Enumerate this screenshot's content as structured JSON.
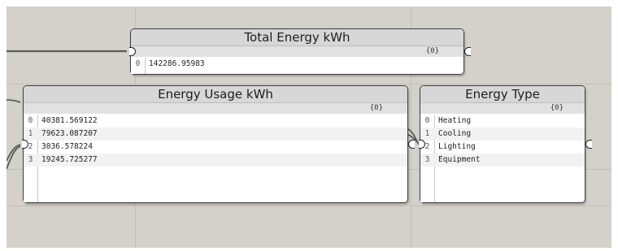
{
  "colors": {
    "canvas": "#d4d1ca",
    "grid": "#c2beb6",
    "wire": "#5a5a5a",
    "panel_header": "#d7d7d7"
  },
  "total_energy": {
    "title": "Total Energy kWh",
    "path": "{0}",
    "rows": [
      {
        "index": "0",
        "value": "142286.95983"
      }
    ]
  },
  "energy_usage": {
    "title": "Energy Usage kWh",
    "path": "{0}",
    "rows": [
      {
        "index": "0",
        "value": "40381.569122"
      },
      {
        "index": "1",
        "value": "79623.087207"
      },
      {
        "index": "2",
        "value": "3036.578224"
      },
      {
        "index": "3",
        "value": "19245.725277"
      }
    ]
  },
  "energy_type": {
    "title": "Energy Type",
    "path": "{0}",
    "rows": [
      {
        "index": "0",
        "value": "Heating"
      },
      {
        "index": "1",
        "value": "Cooling"
      },
      {
        "index": "2",
        "value": "Lighting"
      },
      {
        "index": "3",
        "value": "Equipment"
      }
    ]
  }
}
